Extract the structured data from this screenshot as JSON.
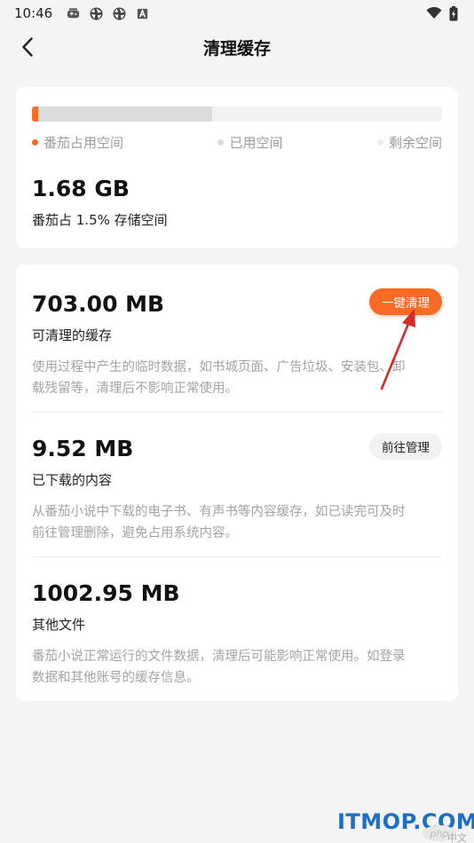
{
  "status_bar": {
    "time": "10:46",
    "icons_left": [
      "gamepad-icon",
      "aperture-icon",
      "aperture-icon",
      "a-badge-icon"
    ],
    "icons_right": [
      "wifi-icon",
      "battery-icon"
    ]
  },
  "nav": {
    "title": "清理缓存",
    "back_icon": "chevron-left-icon"
  },
  "storage_overview": {
    "fanqie_fraction": 0.015,
    "used_fraction": 0.44,
    "legend": [
      "番茄占用空间",
      "已用空间",
      "剩余空间"
    ],
    "colors": {
      "fanqie": "#fa6a25",
      "used": "#dcdcdc",
      "free": "#f1f1f1"
    },
    "total_size": "1.68 GB",
    "total_sub": "番茄占 1.5% 存储空间"
  },
  "sections": [
    {
      "size": "703.00 MB",
      "label": "可清理的缓存",
      "desc_lines": [
        "使用过程中产生的临时数据，如书城页面、广告垃圾、安装包、卸",
        "载残留等，清理后不影响正常使用。"
      ],
      "action": "一键清理"
    },
    {
      "size": "9.52 MB",
      "label": "已下载的内容",
      "desc_lines": [
        "从番茄小说中下载的电子书、有声书等内容缓存，如已读完可及时",
        "前往管理删除，避免占用系统内容。"
      ],
      "action": "前往管理"
    },
    {
      "size": "1002.95 MB",
      "label": "其他文件",
      "desc_lines": [
        "番茄小说正常运行的文件数据，清理后可能影响正常使用。如登录",
        "数据和其他账号的缓存信息。"
      ]
    }
  ],
  "watermark": {
    "main": "ITMOP.COM",
    "php": "php",
    "cn": "中文网"
  }
}
